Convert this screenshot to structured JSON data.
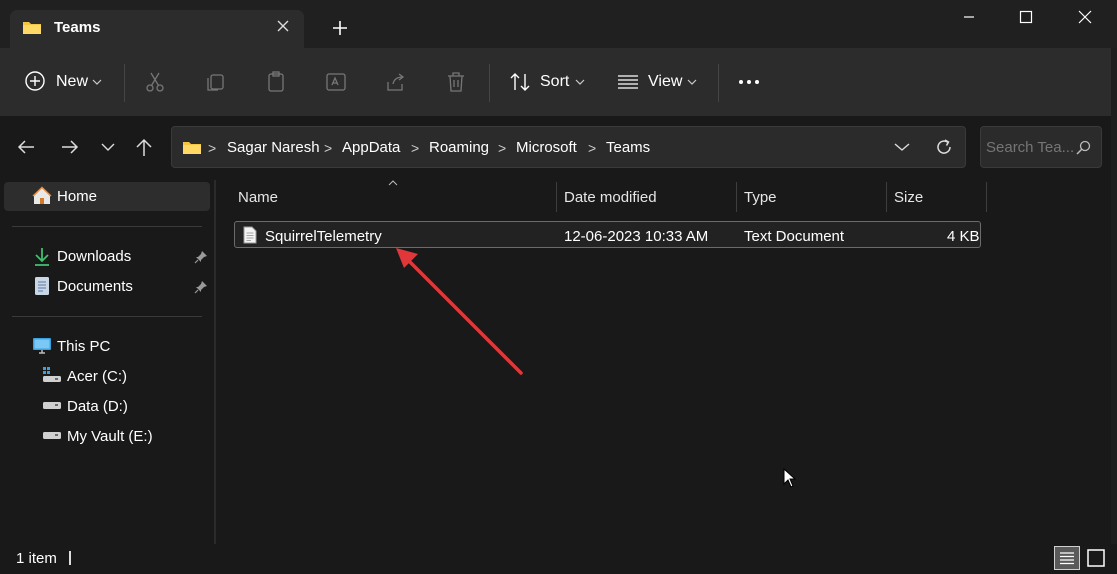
{
  "window": {
    "tab_title": "Teams"
  },
  "toolbar": {
    "new_label": "New",
    "sort_label": "Sort",
    "view_label": "View"
  },
  "address": {
    "crumbs": [
      "Sagar Naresh",
      "AppData",
      "Roaming",
      "Microsoft",
      "Teams"
    ],
    "search_placeholder": "Search Tea..."
  },
  "sidebar": {
    "home": "Home",
    "quick": [
      {
        "label": "Downloads"
      },
      {
        "label": "Documents"
      }
    ],
    "thispc": "This PC",
    "drives": [
      {
        "label": "Acer (C:)"
      },
      {
        "label": "Data (D:)"
      },
      {
        "label": "My Vault (E:)"
      }
    ]
  },
  "columns": {
    "name": "Name",
    "date": "Date modified",
    "type": "Type",
    "size": "Size"
  },
  "files": [
    {
      "name": "SquirrelTelemetry",
      "date": "12-06-2023 10:33 AM",
      "type": "Text Document",
      "size": "4 KB"
    }
  ],
  "status": {
    "count": "1 item"
  },
  "colors": {
    "folder": "#f5c542",
    "annotation_arrow": "#e0383a",
    "download": "#3fbf6f"
  }
}
